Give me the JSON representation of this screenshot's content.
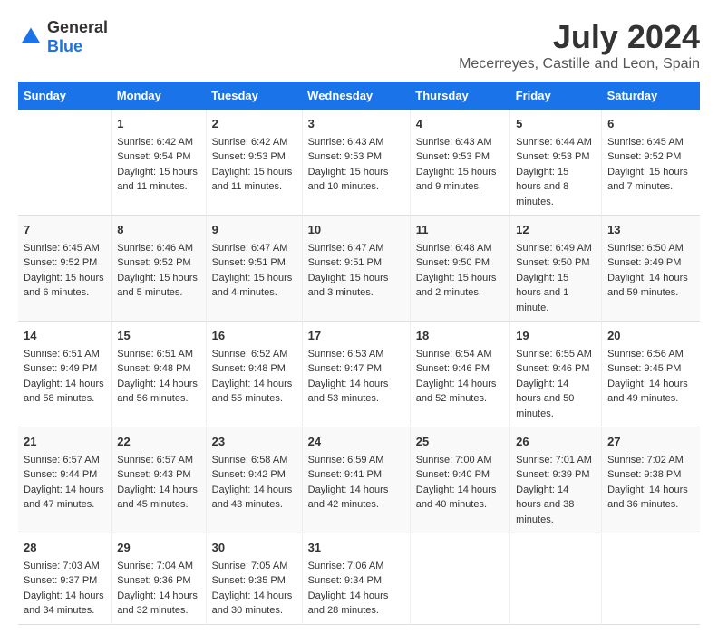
{
  "logo": {
    "general": "General",
    "blue": "Blue"
  },
  "title": "July 2024",
  "subtitle": "Mecerreyes, Castille and Leon, Spain",
  "days": [
    "Sunday",
    "Monday",
    "Tuesday",
    "Wednesday",
    "Thursday",
    "Friday",
    "Saturday"
  ],
  "weeks": [
    [
      {
        "date": "",
        "sunrise": "",
        "sunset": "",
        "daylight": ""
      },
      {
        "date": "1",
        "sunrise": "Sunrise: 6:42 AM",
        "sunset": "Sunset: 9:54 PM",
        "daylight": "Daylight: 15 hours and 11 minutes."
      },
      {
        "date": "2",
        "sunrise": "Sunrise: 6:42 AM",
        "sunset": "Sunset: 9:53 PM",
        "daylight": "Daylight: 15 hours and 11 minutes."
      },
      {
        "date": "3",
        "sunrise": "Sunrise: 6:43 AM",
        "sunset": "Sunset: 9:53 PM",
        "daylight": "Daylight: 15 hours and 10 minutes."
      },
      {
        "date": "4",
        "sunrise": "Sunrise: 6:43 AM",
        "sunset": "Sunset: 9:53 PM",
        "daylight": "Daylight: 15 hours and 9 minutes."
      },
      {
        "date": "5",
        "sunrise": "Sunrise: 6:44 AM",
        "sunset": "Sunset: 9:53 PM",
        "daylight": "Daylight: 15 hours and 8 minutes."
      },
      {
        "date": "6",
        "sunrise": "Sunrise: 6:45 AM",
        "sunset": "Sunset: 9:52 PM",
        "daylight": "Daylight: 15 hours and 7 minutes."
      }
    ],
    [
      {
        "date": "7",
        "sunrise": "Sunrise: 6:45 AM",
        "sunset": "Sunset: 9:52 PM",
        "daylight": "Daylight: 15 hours and 6 minutes."
      },
      {
        "date": "8",
        "sunrise": "Sunrise: 6:46 AM",
        "sunset": "Sunset: 9:52 PM",
        "daylight": "Daylight: 15 hours and 5 minutes."
      },
      {
        "date": "9",
        "sunrise": "Sunrise: 6:47 AM",
        "sunset": "Sunset: 9:51 PM",
        "daylight": "Daylight: 15 hours and 4 minutes."
      },
      {
        "date": "10",
        "sunrise": "Sunrise: 6:47 AM",
        "sunset": "Sunset: 9:51 PM",
        "daylight": "Daylight: 15 hours and 3 minutes."
      },
      {
        "date": "11",
        "sunrise": "Sunrise: 6:48 AM",
        "sunset": "Sunset: 9:50 PM",
        "daylight": "Daylight: 15 hours and 2 minutes."
      },
      {
        "date": "12",
        "sunrise": "Sunrise: 6:49 AM",
        "sunset": "Sunset: 9:50 PM",
        "daylight": "Daylight: 15 hours and 1 minute."
      },
      {
        "date": "13",
        "sunrise": "Sunrise: 6:50 AM",
        "sunset": "Sunset: 9:49 PM",
        "daylight": "Daylight: 14 hours and 59 minutes."
      }
    ],
    [
      {
        "date": "14",
        "sunrise": "Sunrise: 6:51 AM",
        "sunset": "Sunset: 9:49 PM",
        "daylight": "Daylight: 14 hours and 58 minutes."
      },
      {
        "date": "15",
        "sunrise": "Sunrise: 6:51 AM",
        "sunset": "Sunset: 9:48 PM",
        "daylight": "Daylight: 14 hours and 56 minutes."
      },
      {
        "date": "16",
        "sunrise": "Sunrise: 6:52 AM",
        "sunset": "Sunset: 9:48 PM",
        "daylight": "Daylight: 14 hours and 55 minutes."
      },
      {
        "date": "17",
        "sunrise": "Sunrise: 6:53 AM",
        "sunset": "Sunset: 9:47 PM",
        "daylight": "Daylight: 14 hours and 53 minutes."
      },
      {
        "date": "18",
        "sunrise": "Sunrise: 6:54 AM",
        "sunset": "Sunset: 9:46 PM",
        "daylight": "Daylight: 14 hours and 52 minutes."
      },
      {
        "date": "19",
        "sunrise": "Sunrise: 6:55 AM",
        "sunset": "Sunset: 9:46 PM",
        "daylight": "Daylight: 14 hours and 50 minutes."
      },
      {
        "date": "20",
        "sunrise": "Sunrise: 6:56 AM",
        "sunset": "Sunset: 9:45 PM",
        "daylight": "Daylight: 14 hours and 49 minutes."
      }
    ],
    [
      {
        "date": "21",
        "sunrise": "Sunrise: 6:57 AM",
        "sunset": "Sunset: 9:44 PM",
        "daylight": "Daylight: 14 hours and 47 minutes."
      },
      {
        "date": "22",
        "sunrise": "Sunrise: 6:57 AM",
        "sunset": "Sunset: 9:43 PM",
        "daylight": "Daylight: 14 hours and 45 minutes."
      },
      {
        "date": "23",
        "sunrise": "Sunrise: 6:58 AM",
        "sunset": "Sunset: 9:42 PM",
        "daylight": "Daylight: 14 hours and 43 minutes."
      },
      {
        "date": "24",
        "sunrise": "Sunrise: 6:59 AM",
        "sunset": "Sunset: 9:41 PM",
        "daylight": "Daylight: 14 hours and 42 minutes."
      },
      {
        "date": "25",
        "sunrise": "Sunrise: 7:00 AM",
        "sunset": "Sunset: 9:40 PM",
        "daylight": "Daylight: 14 hours and 40 minutes."
      },
      {
        "date": "26",
        "sunrise": "Sunrise: 7:01 AM",
        "sunset": "Sunset: 9:39 PM",
        "daylight": "Daylight: 14 hours and 38 minutes."
      },
      {
        "date": "27",
        "sunrise": "Sunrise: 7:02 AM",
        "sunset": "Sunset: 9:38 PM",
        "daylight": "Daylight: 14 hours and 36 minutes."
      }
    ],
    [
      {
        "date": "28",
        "sunrise": "Sunrise: 7:03 AM",
        "sunset": "Sunset: 9:37 PM",
        "daylight": "Daylight: 14 hours and 34 minutes."
      },
      {
        "date": "29",
        "sunrise": "Sunrise: 7:04 AM",
        "sunset": "Sunset: 9:36 PM",
        "daylight": "Daylight: 14 hours and 32 minutes."
      },
      {
        "date": "30",
        "sunrise": "Sunrise: 7:05 AM",
        "sunset": "Sunset: 9:35 PM",
        "daylight": "Daylight: 14 hours and 30 minutes."
      },
      {
        "date": "31",
        "sunrise": "Sunrise: 7:06 AM",
        "sunset": "Sunset: 9:34 PM",
        "daylight": "Daylight: 14 hours and 28 minutes."
      },
      {
        "date": "",
        "sunrise": "",
        "sunset": "",
        "daylight": ""
      },
      {
        "date": "",
        "sunrise": "",
        "sunset": "",
        "daylight": ""
      },
      {
        "date": "",
        "sunrise": "",
        "sunset": "",
        "daylight": ""
      }
    ]
  ]
}
